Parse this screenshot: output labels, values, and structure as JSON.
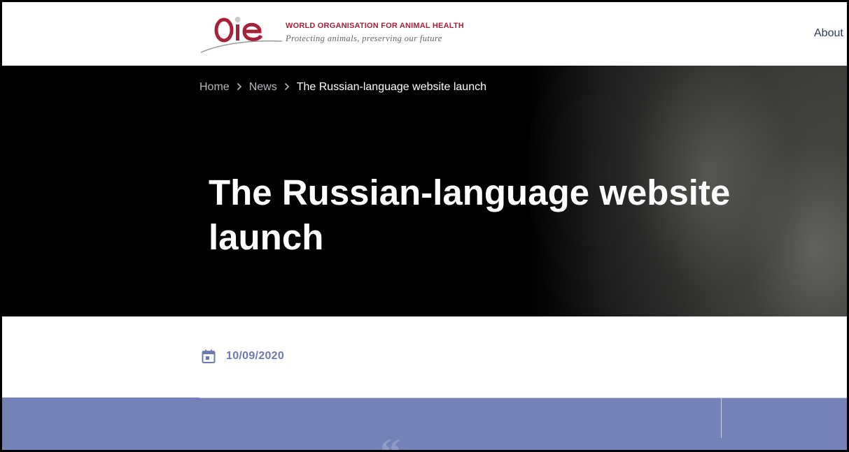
{
  "header": {
    "logo_text": "OIE",
    "org_name": "WORLD ORGANISATION FOR ANIMAL HEALTH",
    "tagline": "Protecting animals, preserving our future",
    "nav": {
      "about_label": "About"
    }
  },
  "breadcrumb": {
    "items": [
      "Home",
      "News"
    ],
    "current": "The Russian-language website launch"
  },
  "article": {
    "title": "The Russian-language website launch",
    "date": "10/09/2020"
  },
  "colors": {
    "brand_red": "#a8213a",
    "accent_blue": "#7482b8",
    "date_color": "#6d7bb0"
  },
  "icons": {
    "date": "calendar-icon",
    "breadcrumb_separator": "chevron-right-icon"
  }
}
